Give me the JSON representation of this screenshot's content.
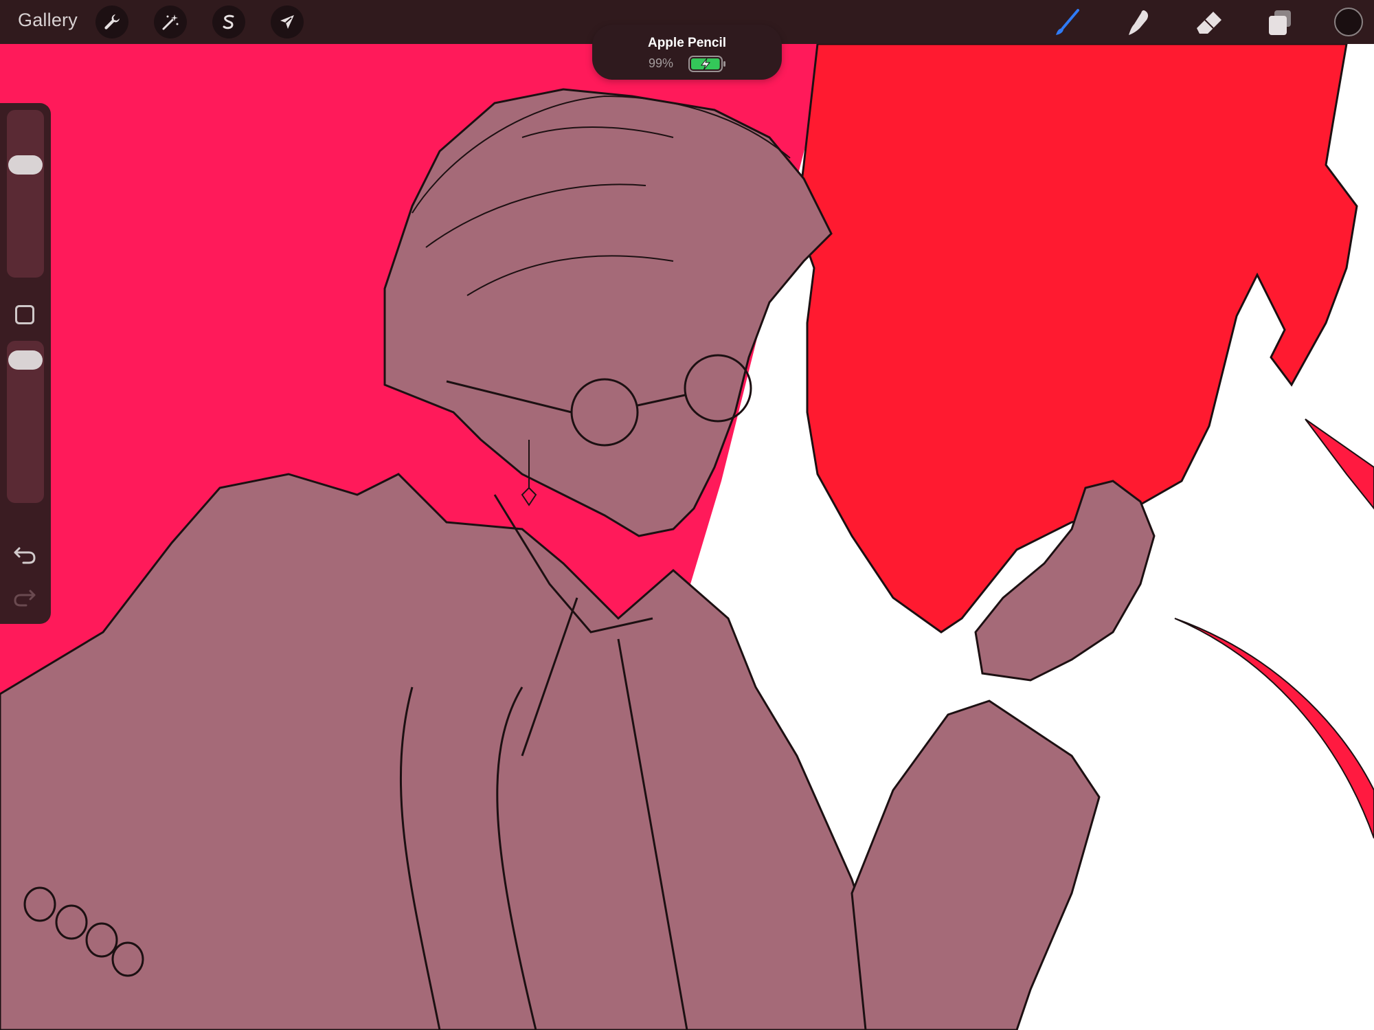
{
  "app": {
    "gallery_label": "Gallery"
  },
  "toolbar_left": [
    {
      "name": "actions",
      "icon": "wrench-icon"
    },
    {
      "name": "adjustments",
      "icon": "magic-wand-icon"
    },
    {
      "name": "selection",
      "icon": "selection-s-icon"
    },
    {
      "name": "transform",
      "icon": "arrow-cursor-icon"
    }
  ],
  "toolbar_right": [
    {
      "name": "brush",
      "icon": "brush-icon",
      "active": true,
      "color": "#2f7bf5"
    },
    {
      "name": "smudge",
      "icon": "smudge-finger-icon",
      "active": false
    },
    {
      "name": "eraser",
      "icon": "eraser-icon",
      "active": false
    },
    {
      "name": "layers",
      "icon": "layers-icon",
      "active": false
    }
  ],
  "current_color": "#1a0f11",
  "pencil_popup": {
    "title": "Apple Pencil",
    "battery_text": "99%",
    "battery_level": 0.99,
    "charging": true
  },
  "sidebar": {
    "brush_size_level": 0.7,
    "opacity_level": 0.95,
    "icons": [
      "modify-square-icon",
      "undo-icon",
      "redo-icon"
    ]
  },
  "colors": {
    "toolbar_bg": "#301a1d",
    "sidebar_bg": "#3a1c22",
    "figure_fill": "#a56a78",
    "red_bg": "#ff1744",
    "magenta_bg": "#ff1a5a",
    "line_art": "#1c1012"
  }
}
